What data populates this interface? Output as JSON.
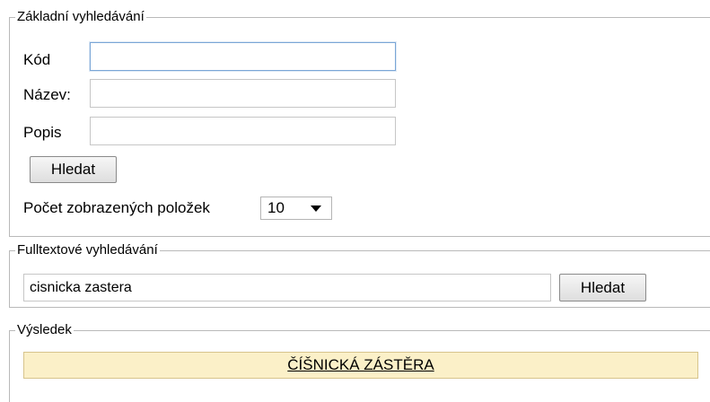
{
  "basic_search": {
    "legend": "Základní vyhledávání",
    "code_label": "Kód",
    "code_value": "",
    "name_label": "Název:",
    "name_value": "",
    "description_label": "Popis",
    "description_value": "",
    "search_button": "Hledat",
    "page_size_label": "Počet zobrazených položek",
    "page_size_value": "10"
  },
  "fulltext_search": {
    "legend": "Fulltextové vyhledávání",
    "query_value": "cisnicka zastera",
    "search_button": "Hledat"
  },
  "result": {
    "legend": "Výsledek",
    "items": [
      {
        "label": "ČÍŠNICKÁ ZÁSTĚRA"
      }
    ],
    "highlight_color": "#fbf0c8"
  }
}
